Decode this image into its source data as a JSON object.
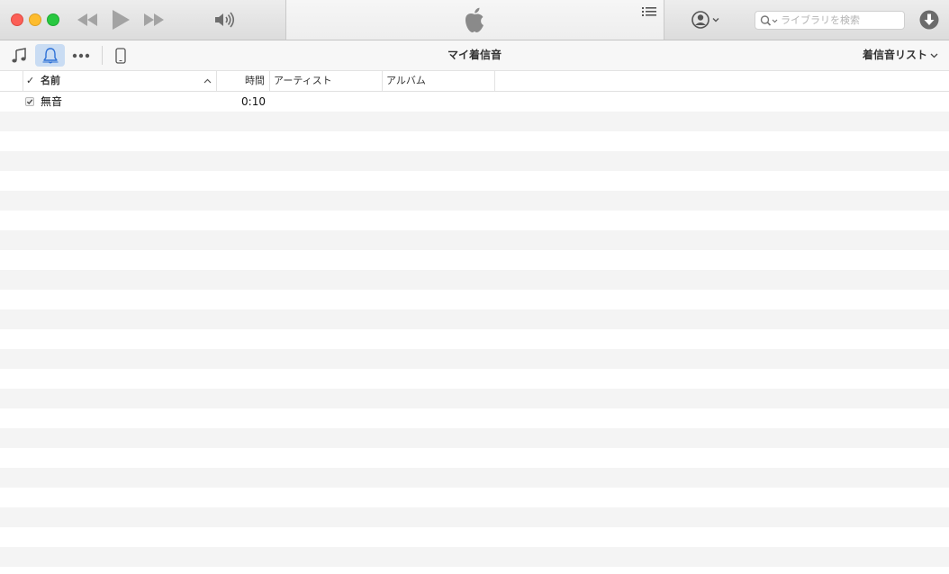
{
  "player": {
    "volume_icon": "speaker-volume-icon",
    "center_logo": "apple-logo-icon",
    "up_next_icon": "list-icon",
    "account_icon": "account-icon"
  },
  "search": {
    "placeholder": "ライブラリを検索"
  },
  "toolbar": {
    "media_icons": [
      "music-note-icon",
      "bell-icon",
      "more-icon",
      "iphone-icon"
    ],
    "title": "マイ着信音",
    "view_menu_label": "着信音リスト"
  },
  "table": {
    "headers": {
      "check": "✓",
      "name": "名前",
      "time": "時間",
      "artist": "アーティスト",
      "album": "アルバム"
    },
    "rows": [
      {
        "checked": true,
        "name": "無音",
        "time": "0:10",
        "artist": "",
        "album": ""
      }
    ]
  },
  "colors": {
    "accent_selected": "#c9dcf3",
    "close": "#fc5f57",
    "minimize": "#fdbc2e",
    "zoom": "#28c840",
    "stripe": "#f4f4f4"
  }
}
